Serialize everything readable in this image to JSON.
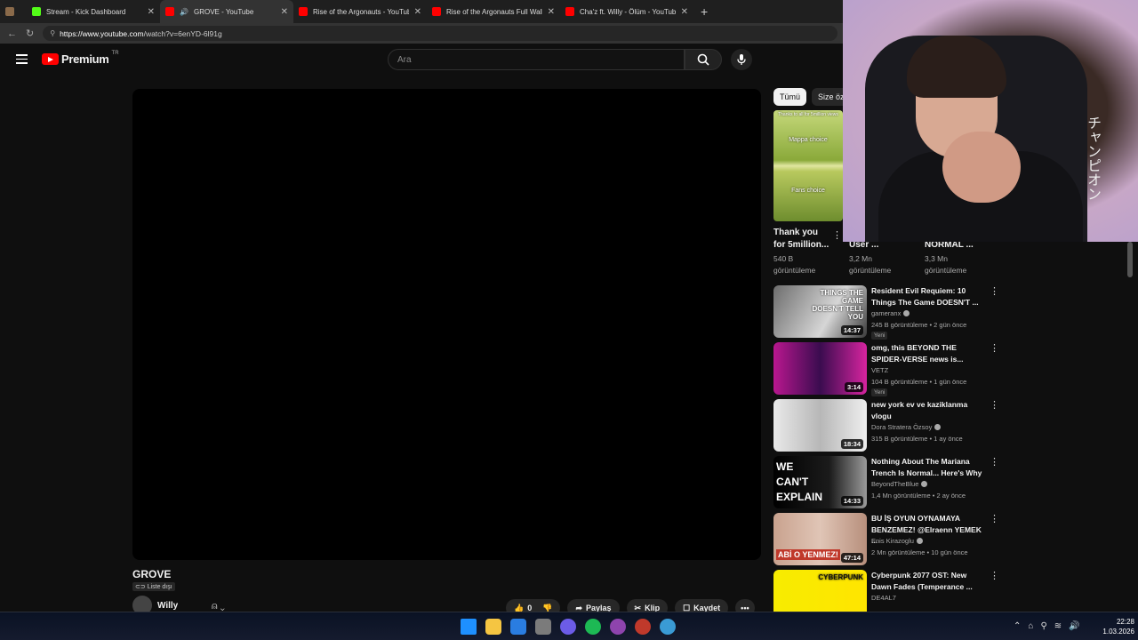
{
  "browser": {
    "tabs": [
      {
        "label": "",
        "color": "#8a6a4a",
        "close": ""
      },
      {
        "label": "Stream - Kick Dashboard",
        "color": "#53fc18",
        "close": "✕"
      },
      {
        "label": "GROVE - YouTube",
        "color": "#ff0000",
        "close": "✕"
      },
      {
        "label": "Rise of the Argonauts - YouTube",
        "color": "#ff0000",
        "close": "✕"
      },
      {
        "label": "Rise of the Argonauts Full Walkthr",
        "color": "#ff0000",
        "close": "✕"
      },
      {
        "label": "Cha'z ft. Willy - Ölüm - YouTube",
        "color": "#ff0000",
        "close": "✕"
      }
    ],
    "new_tab": "+",
    "url_host": "https://www.youtube.com",
    "url_path": "/watch?v=6enYD-6l91g"
  },
  "masthead": {
    "logo_text": "Premium",
    "country": "TR",
    "search_placeholder": "Ara"
  },
  "video": {
    "title": "GROVE",
    "visibility": "Liste dışı",
    "channel": "Willy",
    "likes": "0",
    "share": "Paylaş",
    "clip": "Klip",
    "save": "Kaydet",
    "more": "•••"
  },
  "chips": [
    "Tümü",
    "Size öz"
  ],
  "shorts": [
    {
      "title1": "Thank you",
      "title2": "for 5million...",
      "views1": "540 B",
      "views2": "görüntüleme",
      "thumb_top": "Thanks to all for 5million views",
      "thumb_a": "Mappa choice",
      "thumb_b": "Fans choice"
    },
    {
      "title1": "",
      "title2": "User ...",
      "views1": "3,2 Mn",
      "views2": "görüntüleme"
    },
    {
      "title1": "",
      "title2": "NORMAL ...",
      "views1": "3,3 Mn",
      "views2": "görüntüleme"
    }
  ],
  "recommendations": [
    {
      "title": "Resident Evil Requiem: 10 Things The Game DOESN'T ...",
      "channel": "gameranx",
      "verified": true,
      "meta": "245 B görüntüleme • 2 gün önce",
      "badge": "Yeni",
      "duration": "14:37",
      "thumb_text": "THINGS THE GAME DOESN'T TELL YOU",
      "thumb_bg": "linear-gradient(120deg,#6d6d6d,#d6d6d6 60%,#3a3a3a)"
    },
    {
      "title": "omg, this BEYOND THE SPIDER-VERSE news is...",
      "channel": "VETZ",
      "verified": false,
      "meta": "104 B görüntüleme • 1 gün önce",
      "badge": "Yeni",
      "duration": "3:14",
      "thumb_text": "",
      "thumb_bg": "linear-gradient(90deg,#b9178f,#3a0c4f 50%,#d6249f)"
    },
    {
      "title": "new york ev ve kaziklanma vlogu",
      "channel": "Dora Stratera Özsoy",
      "verified": true,
      "meta": "315 B görüntüleme • 1 ay önce",
      "badge": "",
      "duration": "18:34",
      "thumb_text": "",
      "thumb_bg": "linear-gradient(90deg,#e9e9e9,#b7b7b7 50%,#eeeeee)"
    },
    {
      "title": "Nothing About The Mariana Trench Is Normal... Here's Why",
      "channel": "BeyondTheBlue",
      "verified": true,
      "meta": "1,4 Mn görüntüleme • 2 ay önce",
      "badge": "",
      "duration": "14:33",
      "thumb_text": "WE CAN'T EXPLAIN",
      "thumb_bg": "linear-gradient(90deg,#000,#1b1b1b 60%,#9a9a9a)"
    },
    {
      "title": "BU İŞ OYUN OYNAMAYA BENZEMEZ! @Elraenn YEMEK ...",
      "channel": "Enis Kirazoglu",
      "verified": true,
      "meta": "2 Mn görüntüleme • 10 gün önce",
      "badge": "",
      "duration": "47:14",
      "thumb_text": "ABİ O YENMEZ!",
      "thumb_bg": "linear-gradient(90deg,#c9a28e,#e0c5b6 50%,#b78f7c)"
    },
    {
      "title": "Cyberpunk 2077 OST: New Dawn Fades (Temperance ...",
      "channel": "DE4AL7",
      "verified": false,
      "meta": "",
      "badge": "",
      "duration": "",
      "thumb_text": "CYBERPUNK",
      "thumb_bg": "linear-gradient(90deg,#f7ec00,#ffe500)"
    }
  ],
  "webcam": {
    "jp_text": "チャンピオン"
  },
  "taskbar": {
    "icons": [
      "#1e90ff",
      "#f5c542",
      "#2a7de1",
      "#7b7b7b",
      "#6c5ce7",
      "#1db954",
      "#8e44ad",
      "#c0392b",
      "#3a9bd5"
    ],
    "time": "22:28",
    "date": "1.03.2026"
  }
}
